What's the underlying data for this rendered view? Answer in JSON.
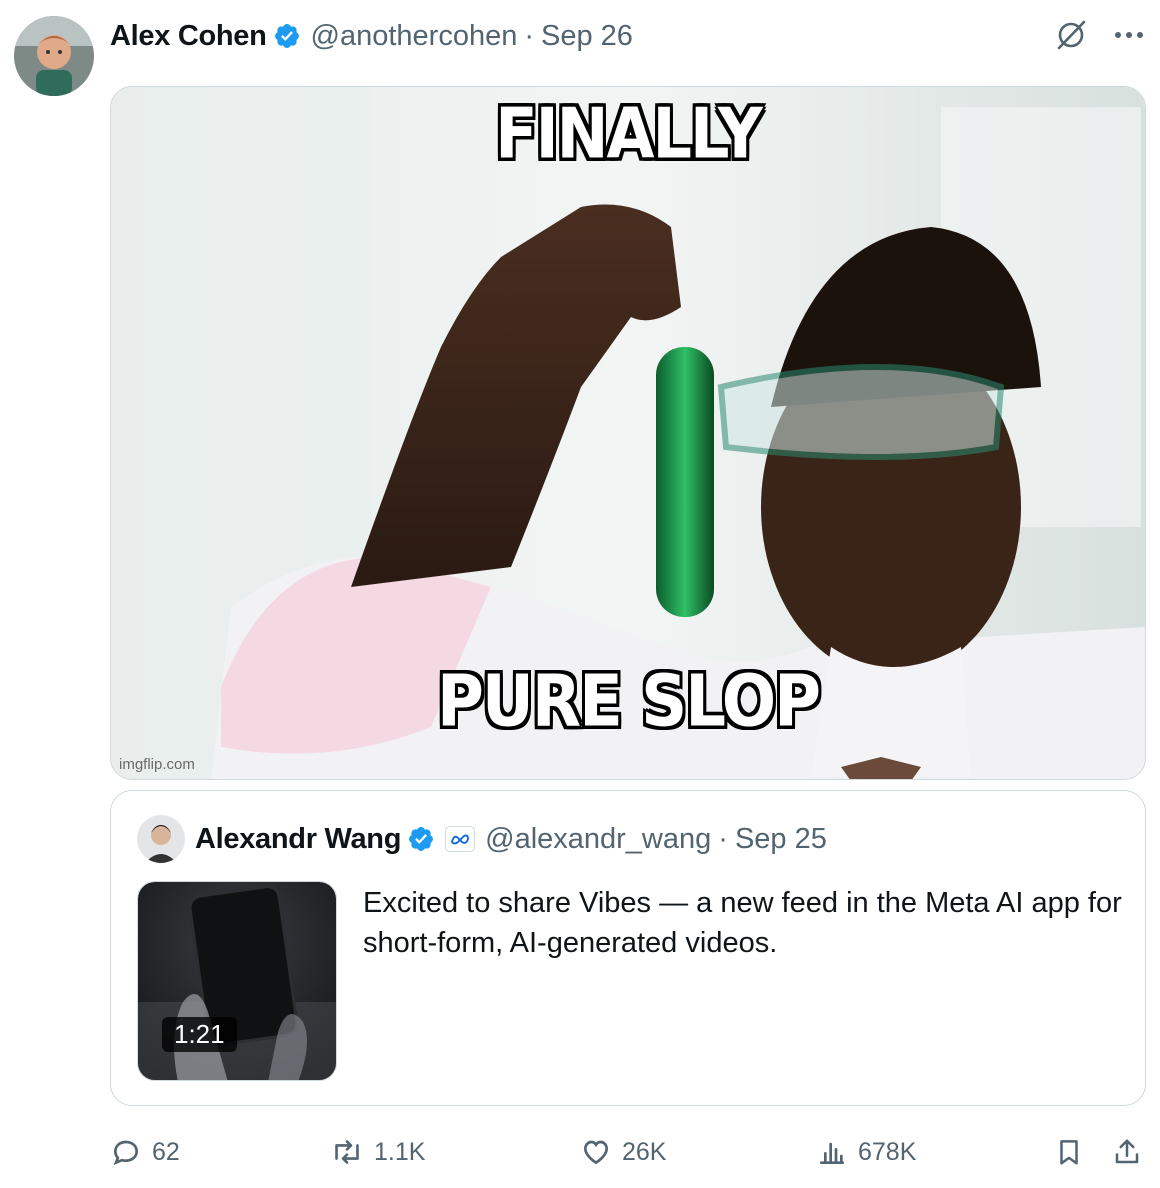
{
  "post": {
    "author_name": "Alex Cohen",
    "handle": "@anothercohen",
    "separator": "·",
    "date": "Sep 26",
    "media": {
      "top_caption": "FINALLY",
      "bottom_caption": "PURE SLOP",
      "watermark": "imgflip.com"
    }
  },
  "quoted": {
    "author_name": "Alexandr Wang",
    "handle": "@alexandr_wang",
    "separator": "·",
    "date": "Sep 25",
    "text": "Excited to share Vibes — a new feed in the Meta AI app for short-form, AI-generated videos.",
    "video_duration": "1:21"
  },
  "actions": {
    "replies": "62",
    "reposts": "1.1K",
    "likes": "26K",
    "views": "678K"
  },
  "icons": [
    "verified-badge-icon",
    "grok-icon",
    "more-icon",
    "meta-affiliate-icon",
    "reply-icon",
    "repost-icon",
    "like-icon",
    "views-icon",
    "bookmark-icon",
    "share-icon"
  ],
  "colors": {
    "verified": "#1d9bf0",
    "secondary_text": "#536471",
    "border": "#cfd9de"
  }
}
